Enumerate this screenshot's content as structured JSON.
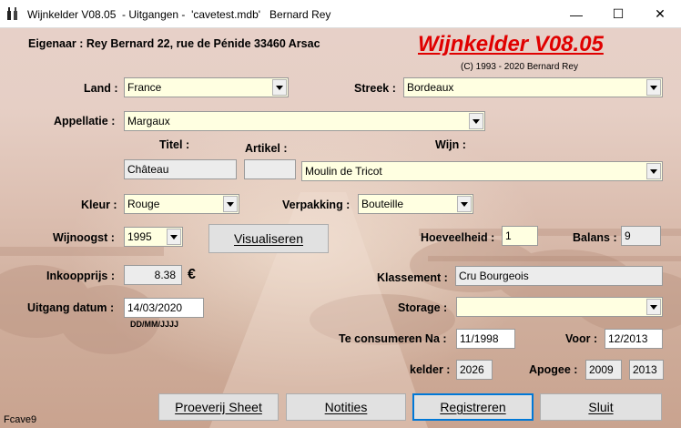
{
  "window": {
    "title": "Wijnkelder V08.05  - Uitgangen -  'cavetest.mdb'   Bernard Rey",
    "minimize": "—",
    "maximize": "☐",
    "close": "✕"
  },
  "header": {
    "owner": "Eigenaar : Rey Bernard 22, rue de Pénide 33460 Arsac",
    "brand": "Wijnkelder V08.05",
    "copyright": "(C) 1993 - 2020 Bernard Rey"
  },
  "form": {
    "land_label": "Land :",
    "land_value": "France",
    "streek_label": "Streek :",
    "streek_value": "Bordeaux",
    "appellatie_label": "Appellatie :",
    "appellatie_value": "Margaux",
    "titel_label": "Titel :",
    "titel_value": "Château",
    "artikel_label": "Artikel :",
    "artikel_value": "",
    "wijn_label": "Wijn :",
    "wijn_value": "Moulin de Tricot",
    "kleur_label": "Kleur :",
    "kleur_value": "Rouge",
    "verpakking_label": "Verpakking :",
    "verpakking_value": "Bouteille",
    "wijnoogst_label": "Wijnoogst :",
    "wijnoogst_value": "1995",
    "hoeveelheid_label": "Hoeveelheid :",
    "hoeveelheid_value": "1",
    "balans_label": "Balans :",
    "balans_value": "9",
    "inkoopprijs_label": "Inkoopprijs :",
    "inkoopprijs_value": "8.38",
    "currency": "€",
    "klassement_label": "Klassement :",
    "klassement_value": "Cru Bourgeois",
    "uitgang_label": "Uitgang datum :",
    "uitgang_value": "14/03/2020",
    "date_format": "DD/MM/JJJJ",
    "storage_label": "Storage :",
    "storage_value": "",
    "consumeren_label": "Te consumeren Na :",
    "consumeren_value": "11/1998",
    "voor_label": "Voor :",
    "voor_value": "12/2013",
    "kelder_label": "kelder :",
    "kelder_value": "2026",
    "apogee_label": "Apogee :",
    "apogee_from": "2009",
    "apogee_to": "2013"
  },
  "buttons": {
    "visualiseren": "Visualiseren",
    "proeverij": "Proeverij Sheet",
    "notities": "Notities",
    "registreren": "Registreren",
    "sluit": "Sluit"
  },
  "status": {
    "form_name": "Fcave9"
  }
}
